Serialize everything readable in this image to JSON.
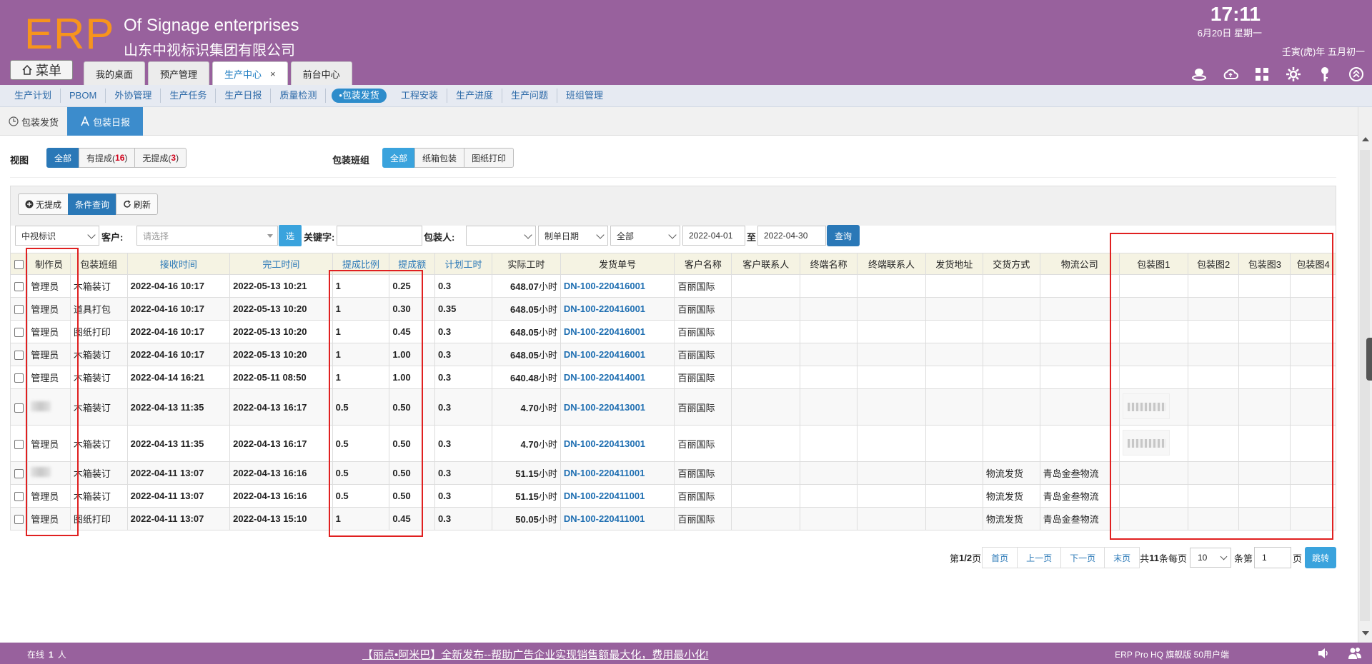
{
  "header": {
    "logo": "ERP",
    "company_en": "Of Signage enterprises",
    "company_cn": "山东中视标识集团有限公司",
    "time": "17:11",
    "date": "6月20日 星期一",
    "lunar": "壬寅(虎)年 五月初一",
    "menu_label": "菜单",
    "tabs": [
      {
        "label": "我的桌面"
      },
      {
        "label": "预产管理"
      },
      {
        "label": "生产中心",
        "close": "×"
      },
      {
        "label": "前台中心"
      }
    ]
  },
  "modules": [
    "生产计划",
    "PBOM",
    "外协管理",
    "生产任务",
    "生产日报",
    "质量检测",
    "•包装发货",
    "工程安装",
    "生产进度",
    "生产问题",
    "班组管理"
  ],
  "sub_tabs": [
    "包装发货",
    "包装日报"
  ],
  "filters": {
    "view_label": "视图",
    "view_all": "全部",
    "view_with": "有提成(",
    "view_with_count": "16",
    "view_without": "无提成(",
    "view_without_count": "3",
    "close_paren": ")",
    "team_label": "包装班组",
    "team_all": "全部",
    "team_carton": "纸箱包装",
    "team_print": "图纸打印"
  },
  "toolbar": {
    "no_commission": "无提成",
    "cond_query": "条件查询",
    "refresh": "刷新"
  },
  "query": {
    "company": "中视标识",
    "customer_label": "客户:",
    "customer_placeholder": "请选择",
    "pick": "选",
    "keyword_label": "关键字:",
    "keyword_value": "",
    "packer_label": "包装人:",
    "packer_value": "",
    "date_type": "制单日期",
    "range": "全部",
    "date_from": "2022-04-01",
    "to": "至",
    "date_to": "2022-04-30",
    "search": "查询"
  },
  "table": {
    "columns": [
      "制作员",
      "包装班组",
      "接收时间",
      "完工时间",
      "提成比例",
      "提成额",
      "计划工时",
      "实际工时",
      "发货单号",
      "客户名称",
      "客户联系人",
      "终端名称",
      "终端联系人",
      "发货地址",
      "交货方式",
      "物流公司",
      "包装图1",
      "包装图2",
      "包装图3",
      "包装图4"
    ],
    "hour_unit": "小时",
    "rows": [
      {
        "maker": "管理员",
        "team": "木箱装订",
        "recv": "2022-04-16 10:17",
        "done": "2022-05-13 10:21",
        "ratio": "1",
        "amount": "0.25",
        "plan": "0.3",
        "actual": "648.07",
        "no": "DN-100-220416001",
        "customer": "百丽国际",
        "delivery": "",
        "logistics": "",
        "img1": false
      },
      {
        "maker": "管理员",
        "team": "道具打包",
        "recv": "2022-04-16 10:17",
        "done": "2022-05-13 10:20",
        "ratio": "1",
        "amount": "0.30",
        "plan": "0.35",
        "actual": "648.05",
        "no": "DN-100-220416001",
        "customer": "百丽国际",
        "delivery": "",
        "logistics": "",
        "img1": false
      },
      {
        "maker": "管理员",
        "team": "图纸打印",
        "recv": "2022-04-16 10:17",
        "done": "2022-05-13 10:20",
        "ratio": "1",
        "amount": "0.45",
        "plan": "0.3",
        "actual": "648.05",
        "no": "DN-100-220416001",
        "customer": "百丽国际",
        "delivery": "",
        "logistics": "",
        "img1": false
      },
      {
        "maker": "管理员",
        "team": "木箱装订",
        "recv": "2022-04-16 10:17",
        "done": "2022-05-13 10:20",
        "ratio": "1",
        "amount": "1.00",
        "plan": "0.3",
        "actual": "648.05",
        "no": "DN-100-220416001",
        "customer": "百丽国际",
        "delivery": "",
        "logistics": "",
        "img1": false
      },
      {
        "maker": "管理员",
        "team": "木箱装订",
        "recv": "2022-04-14 16:21",
        "done": "2022-05-11 08:50",
        "ratio": "1",
        "amount": "1.00",
        "plan": "0.3",
        "actual": "640.48",
        "no": "DN-100-220414001",
        "customer": "百丽国际",
        "delivery": "",
        "logistics": "",
        "img1": false
      },
      {
        "maker": "",
        "team": "木箱装订",
        "recv": "2022-04-13 11:35",
        "done": "2022-04-13 16:17",
        "ratio": "0.5",
        "amount": "0.50",
        "plan": "0.3",
        "actual": "4.70",
        "no": "DN-100-220413001",
        "customer": "百丽国际",
        "delivery": "",
        "logistics": "",
        "img1": true,
        "tall": true
      },
      {
        "maker": "管理员",
        "team": "木箱装订",
        "recv": "2022-04-13 11:35",
        "done": "2022-04-13 16:17",
        "ratio": "0.5",
        "amount": "0.50",
        "plan": "0.3",
        "actual": "4.70",
        "no": "DN-100-220413001",
        "customer": "百丽国际",
        "delivery": "",
        "logistics": "",
        "img1": true,
        "tall": true
      },
      {
        "maker": "",
        "team": "木箱装订",
        "recv": "2022-04-11 13:07",
        "done": "2022-04-13 16:16",
        "ratio": "0.5",
        "amount": "0.50",
        "plan": "0.3",
        "actual": "51.15",
        "no": "DN-100-220411001",
        "customer": "百丽国际",
        "delivery": "物流发货",
        "logistics": "青岛金叁物流",
        "img1": false
      },
      {
        "maker": "管理员",
        "team": "木箱装订",
        "recv": "2022-04-11 13:07",
        "done": "2022-04-13 16:16",
        "ratio": "0.5",
        "amount": "0.50",
        "plan": "0.3",
        "actual": "51.15",
        "no": "DN-100-220411001",
        "customer": "百丽国际",
        "delivery": "物流发货",
        "logistics": "青岛金叁物流",
        "img1": false
      },
      {
        "maker": "管理员",
        "team": "图纸打印",
        "recv": "2022-04-11 13:07",
        "done": "2022-04-13 15:10",
        "ratio": "1",
        "amount": "0.45",
        "plan": "0.3",
        "actual": "50.05",
        "no": "DN-100-220411001",
        "customer": "百丽国际",
        "delivery": "物流发货",
        "logistics": "青岛金叁物流",
        "img1": false
      }
    ]
  },
  "pager": {
    "page_prefix": "第",
    "page_info": "1/2",
    "page_suffix": "页",
    "first": "首页",
    "prev": "上一页",
    "next": "下一页",
    "last": "末页",
    "total_prefix": "共",
    "total": "11",
    "total_suffix": "条每页",
    "per_page": "10",
    "goto_prefix": "条第",
    "goto_value": "1",
    "goto_suffix": "页",
    "go": "跳转"
  },
  "footer": {
    "online_label": "在线",
    "online_count": "1",
    "online_unit": "人",
    "marquee": "【丽点•阿米巴】全新发布--帮助广告企业实现销售额最大化，费用最小化!",
    "version": "ERP Pro HQ 旗舰版 50用户端"
  },
  "colors": {
    "header_bg": "#98619d",
    "logo": "#f7941d",
    "primary": "#2a78b7",
    "accent": "#3aa3dd",
    "highlight_box": "#e02020"
  }
}
